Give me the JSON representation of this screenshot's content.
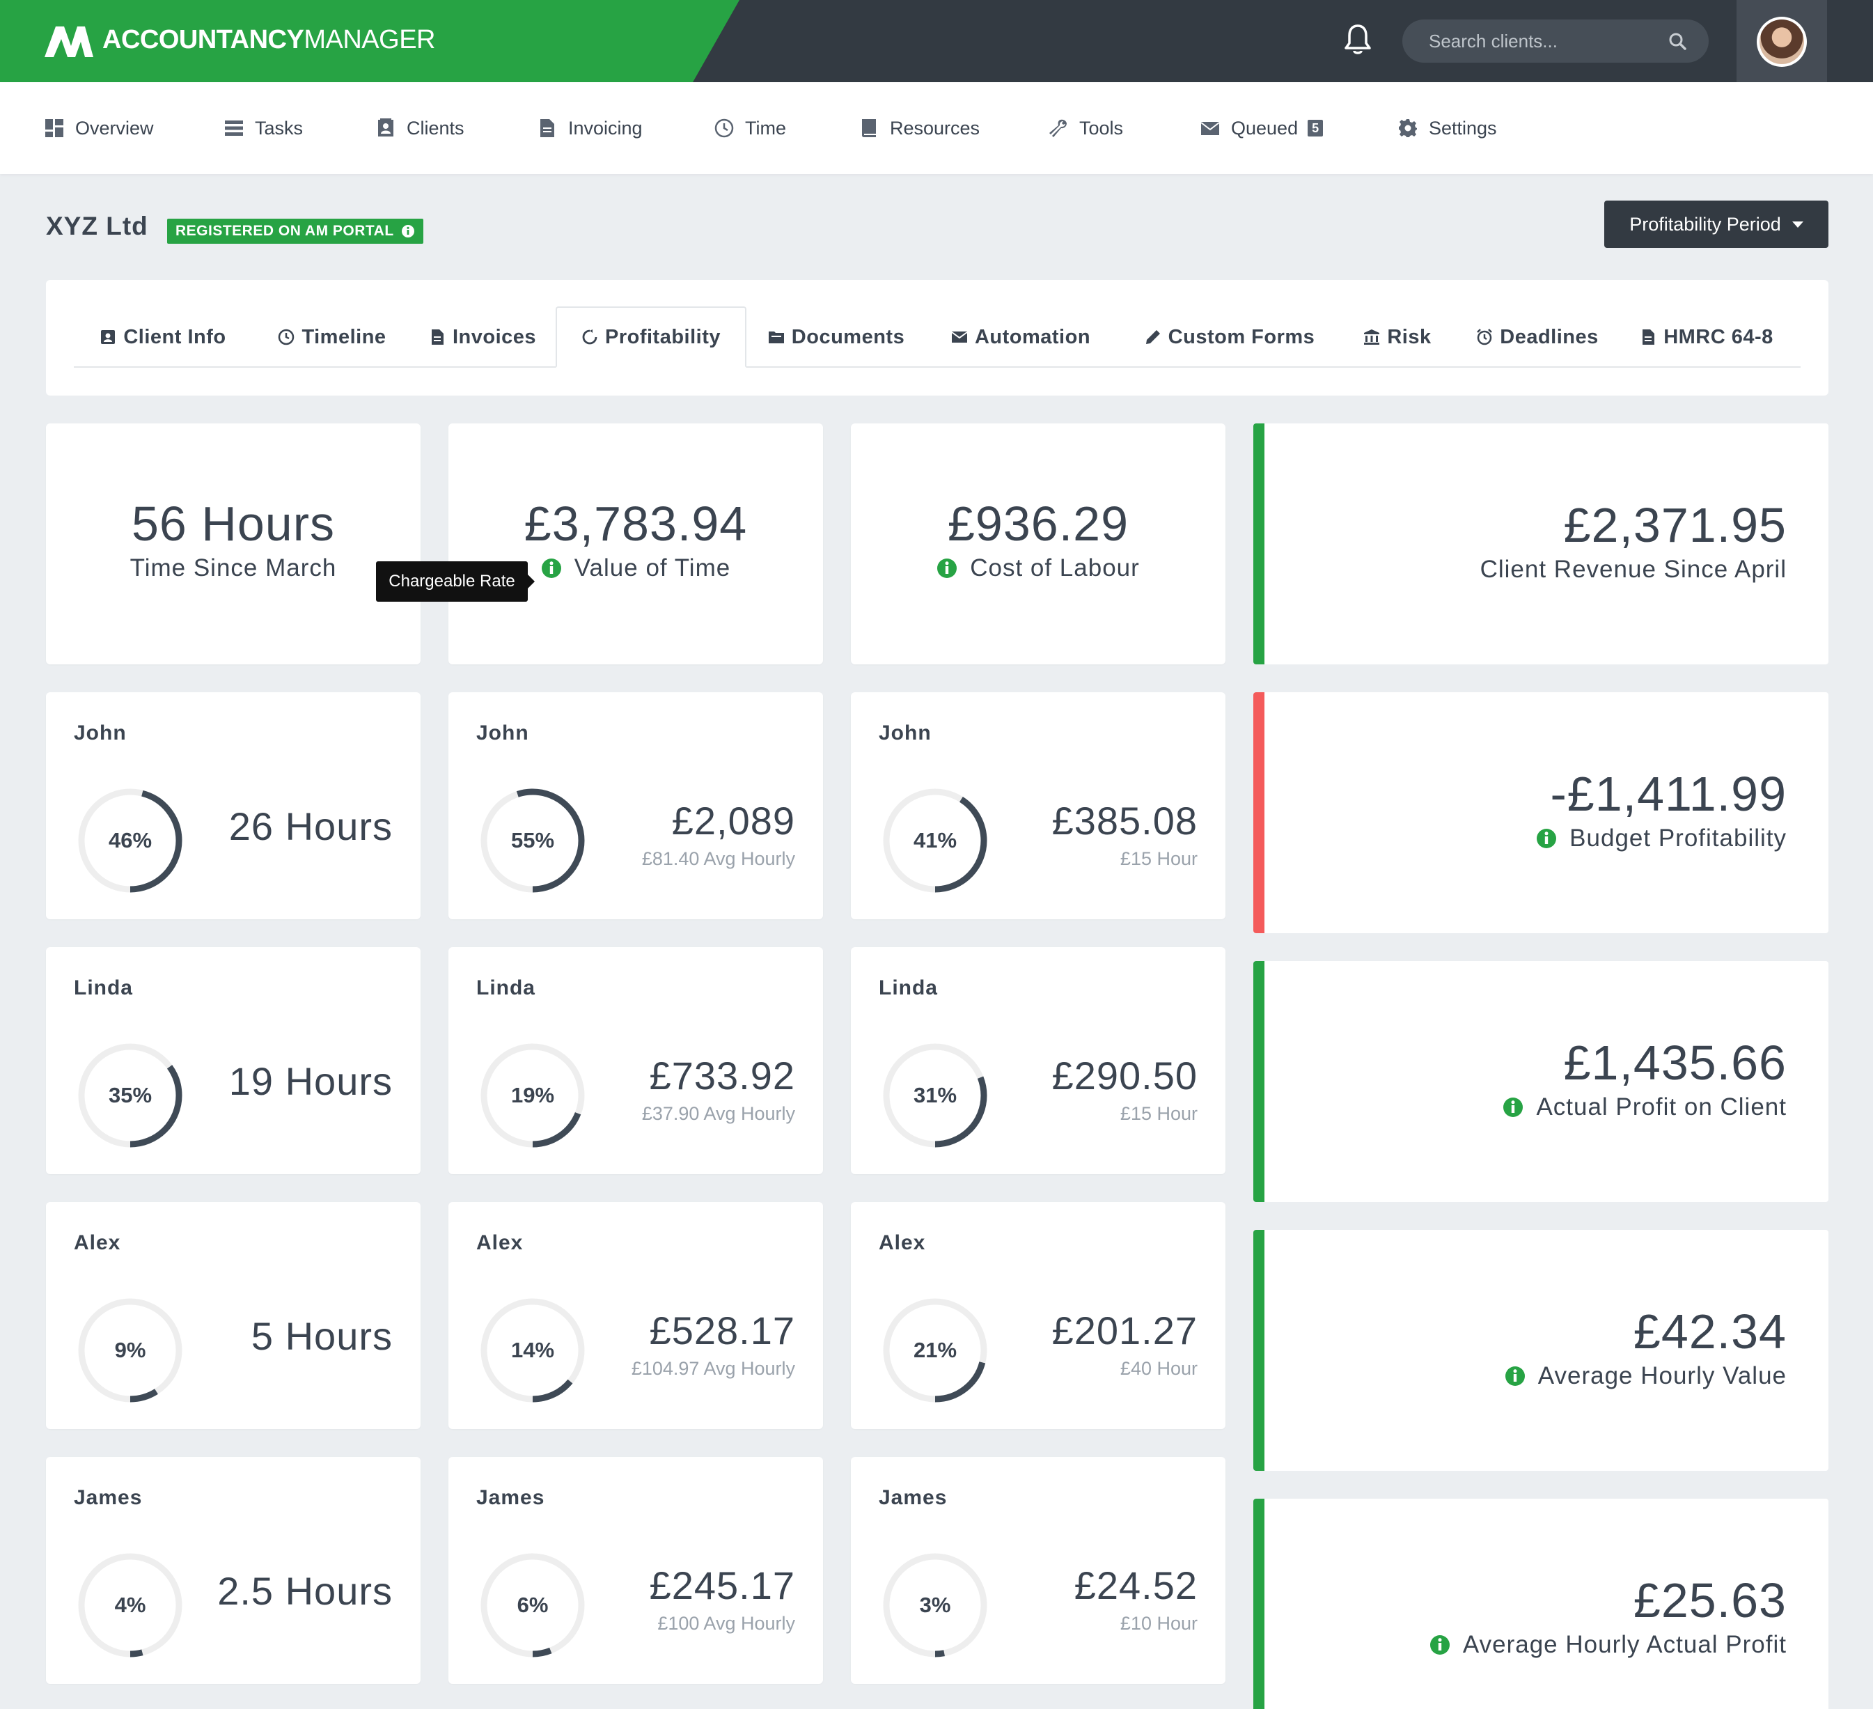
{
  "brand": {
    "name_bold": "ACCOUNTANCY",
    "name_light": "MANAGER"
  },
  "search": {
    "placeholder": "Search clients..."
  },
  "nav": {
    "overview": "Overview",
    "tasks": "Tasks",
    "clients": "Clients",
    "invoicing": "Invoicing",
    "time": "Time",
    "resources": "Resources",
    "tools": "Tools",
    "queued": "Queued",
    "queued_count": "5",
    "settings": "Settings"
  },
  "client": {
    "name": "XYZ Ltd",
    "portal_badge": "REGISTERED ON AM PORTAL"
  },
  "period_button": "Profitability Period",
  "tabs": {
    "client_info": "Client Info",
    "timeline": "Timeline",
    "invoices": "Invoices",
    "profitability": "Profitability",
    "documents": "Documents",
    "automation": "Automation",
    "custom_forms": "Custom Forms",
    "risk": "Risk",
    "deadlines": "Deadlines",
    "hmrc": "HMRC 64-8"
  },
  "summary": {
    "time": {
      "value": "56 Hours",
      "label": "Time Since March"
    },
    "value_of_time": {
      "value": "£3,783.94",
      "label": "Value of Time"
    },
    "cost": {
      "value": "£936.29",
      "label": "Cost of Labour"
    }
  },
  "tooltip": "Chargeable Rate",
  "colors": {
    "green": "#27a344",
    "red": "#f45b5b",
    "dark": "#333a42",
    "ring": "#3f4a56",
    "track": "#eeeeee"
  },
  "staff": [
    {
      "name": "John",
      "hours": {
        "pct": 46,
        "pct_label": "46%",
        "value": "26 Hours"
      },
      "value": {
        "pct": 55,
        "pct_label": "55%",
        "value": "£2,089",
        "sub": "£81.40 Avg Hourly"
      },
      "cost": {
        "pct": 41,
        "pct_label": "41%",
        "value": "£385.08",
        "sub": "£15 Hour"
      }
    },
    {
      "name": "Linda",
      "hours": {
        "pct": 35,
        "pct_label": "35%",
        "value": "19 Hours"
      },
      "value": {
        "pct": 19,
        "pct_label": "19%",
        "value": "£733.92",
        "sub": "£37.90 Avg Hourly"
      },
      "cost": {
        "pct": 31,
        "pct_label": "31%",
        "value": "£290.50",
        "sub": "£15 Hour"
      }
    },
    {
      "name": "Alex",
      "hours": {
        "pct": 9,
        "pct_label": "9%",
        "value": "5 Hours"
      },
      "value": {
        "pct": 14,
        "pct_label": "14%",
        "value": "£528.17",
        "sub": "£104.97 Avg Hourly"
      },
      "cost": {
        "pct": 21,
        "pct_label": "21%",
        "value": "£201.27",
        "sub": "£40 Hour"
      }
    },
    {
      "name": "James",
      "hours": {
        "pct": 4,
        "pct_label": "4%",
        "value": "2.5 Hours"
      },
      "value": {
        "pct": 6,
        "pct_label": "6%",
        "value": "£245.17",
        "sub": "£100 Avg Hourly"
      },
      "cost": {
        "pct": 3,
        "pct_label": "3%",
        "value": "£24.52",
        "sub": "£10 Hour"
      }
    }
  ],
  "side": [
    {
      "value": "£2,371.95",
      "label": "Client Revenue Since April",
      "status": "green",
      "info": false
    },
    {
      "value": "-£1,411.99",
      "label": "Budget Profitability",
      "status": "red",
      "info": true
    },
    {
      "value": "£1,435.66",
      "label": "Actual Profit on Client",
      "status": "green",
      "info": true
    },
    {
      "value": "£42.34",
      "label": "Average Hourly Value",
      "status": "green",
      "info": true
    },
    {
      "value": "£25.63",
      "label": "Average Hourly Actual Profit",
      "status": "green",
      "info": true
    }
  ]
}
